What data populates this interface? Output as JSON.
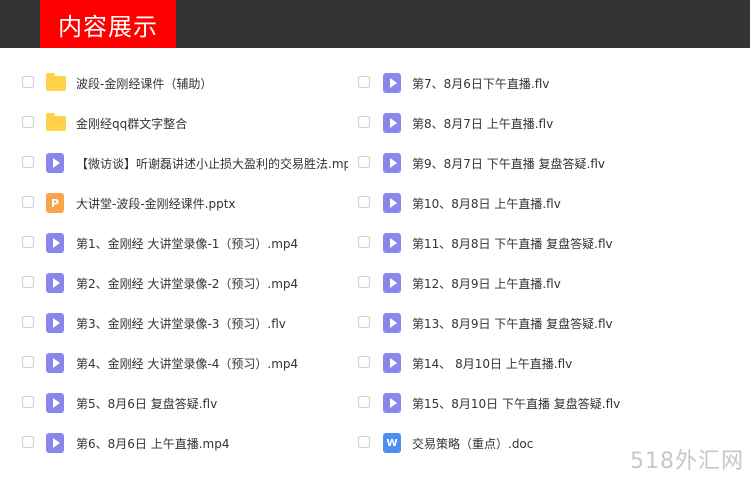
{
  "header": {
    "title": "内容展示"
  },
  "left_items": [
    {
      "label": "波段-金刚经课件（辅助）"
    },
    {
      "label": "金刚经qq群文字整合"
    },
    {
      "label": "【微访谈】听谢磊讲述小止损大盈利的交易胜法.mp"
    },
    {
      "label": "大讲堂-波段-金刚经课件.pptx"
    },
    {
      "label": "第1、金刚经 大讲堂录像-1（预习）.mp4"
    },
    {
      "label": "第2、金刚经 大讲堂录像-2（预习）.mp4"
    },
    {
      "label": "第3、金刚经 大讲堂录像-3（预习）.flv"
    },
    {
      "label": "第4、金刚经 大讲堂录像-4（预习）.mp4"
    },
    {
      "label": "第5、8月6日 复盘答疑.flv"
    },
    {
      "label": "第6、8月6日 上午直播.mp4"
    }
  ],
  "right_items": [
    {
      "label": "第7、8月6日下午直播.flv"
    },
    {
      "label": "第8、8月7日 上午直播.flv"
    },
    {
      "label": "第9、8月7日 下午直播 复盘答疑.flv"
    },
    {
      "label": "第10、8月8日 上午直播.flv"
    },
    {
      "label": "第11、8月8日 下午直播 复盘答疑.flv"
    },
    {
      "label": "第12、8月9日 上午直播.flv"
    },
    {
      "label": "第13、8月9日 下午直播 复盘答疑.flv"
    },
    {
      "label": "第14、 8月10日 上午直播.flv"
    },
    {
      "label": "第15、8月10日 下午直播 复盘答疑.flv"
    },
    {
      "label": "交易策略（重点）.doc"
    }
  ],
  "icons": {
    "ppt_letter": "P",
    "doc_letter": "W"
  },
  "watermark": "518外汇网"
}
